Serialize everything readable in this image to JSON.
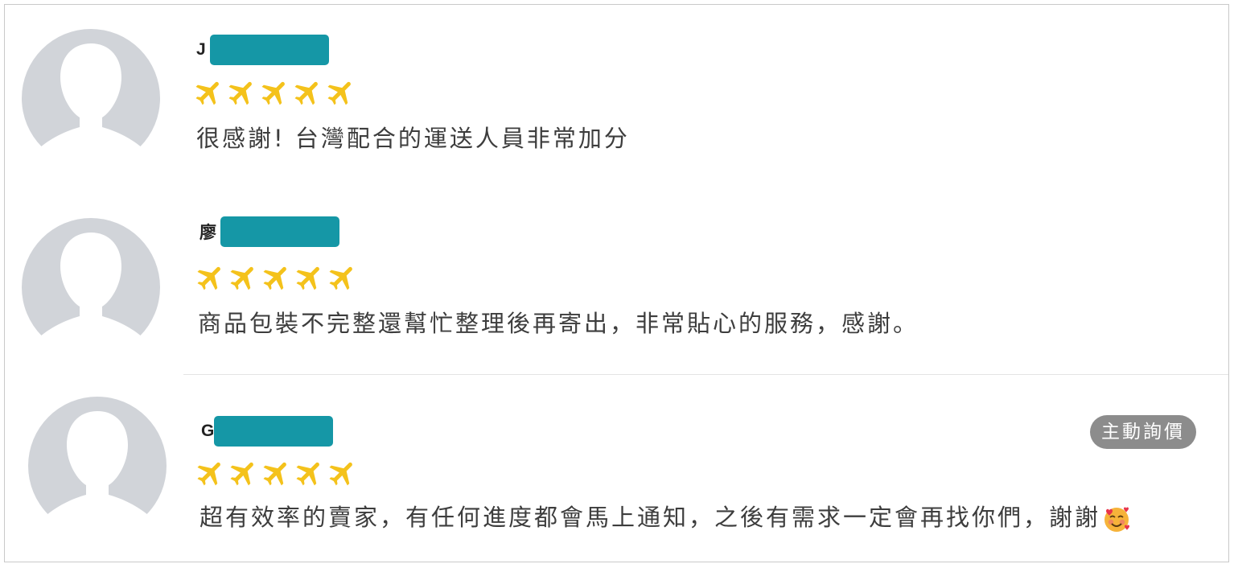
{
  "reviews": [
    {
      "name_prefix": "J",
      "rating": 5,
      "comment": "很感謝! 台灣配合的運送人員非常加分"
    },
    {
      "name_prefix": "廖",
      "rating": 5,
      "comment": "商品包裝不完整還幫忙整理後再寄出，非常貼心的服務，感謝。"
    },
    {
      "name_prefix": "Ga",
      "rating": 5,
      "comment": "超有效率的賣家，有任何進度都會馬上通知，之後有需求一定會再找你們，謝謝",
      "badge": "主動詢價",
      "trailing_emoji": "smiling-face-with-hearts"
    }
  ],
  "icons": {
    "avatar": "default-user-silhouette-icon",
    "rating_mark": "airplane-icon"
  },
  "colors": {
    "rating": "#f4c21b",
    "redaction": "#1597a6",
    "avatar": "#d1d4d9",
    "badge": "#8c8c8c"
  }
}
